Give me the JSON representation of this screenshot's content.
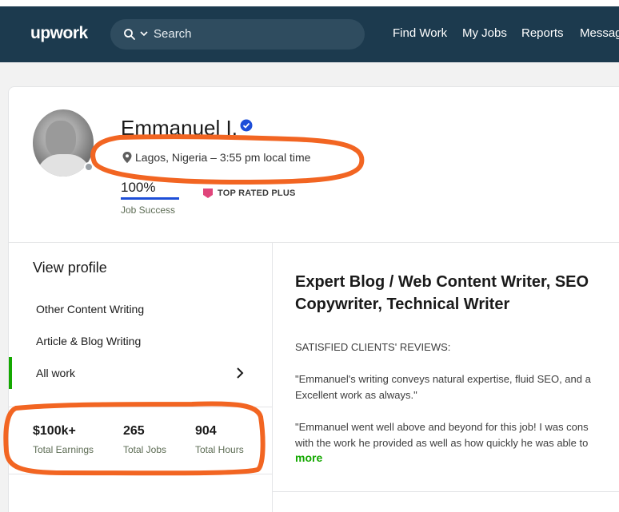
{
  "nav": {
    "logo": "upwork",
    "search_placeholder": "Search",
    "links": [
      "Find Work",
      "My Jobs",
      "Reports",
      "Messages"
    ]
  },
  "profile": {
    "name": "Emmanuel I.",
    "location": "Lagos, Nigeria – 3:55 pm local time",
    "job_success_value": "100%",
    "job_success_label": "Job Success",
    "badge": "TOP RATED PLUS"
  },
  "sidebar": {
    "view_profile": "View profile",
    "specialties": [
      "Other Content Writing",
      "Article & Blog Writing",
      "All work"
    ]
  },
  "stats": [
    {
      "value": "$100k+",
      "label": "Total Earnings"
    },
    {
      "value": "265",
      "label": "Total Jobs"
    },
    {
      "value": "904",
      "label": "Total Hours"
    }
  ],
  "main": {
    "title": "Expert Blog / Web Content Writer, SEO Copywriter, Technical Writer",
    "reviews_heading": "SATISFIED CLIENTS' REVIEWS:",
    "review1_line1": "\"Emmanuel's writing conveys natural expertise, fluid SEO, and a",
    "review1_line2": "Excellent work as always.\"",
    "review2_line1": "\"Emmanuel went well above and beyond for this job! I was cons",
    "review2_line2": "with the work he provided as well as how quickly he was able to",
    "more": "more"
  },
  "colors": {
    "nav_bg": "#1c3a4e",
    "accent_green": "#14a800",
    "annotation_orange": "#f26522",
    "verified_blue": "#1d4ed8",
    "badge_pink": "#e0457b"
  }
}
